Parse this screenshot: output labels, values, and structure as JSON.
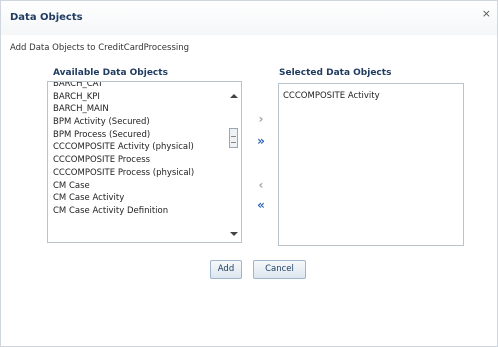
{
  "dialog": {
    "title": "Data Objects",
    "close_glyph": "×",
    "subtitle": "Add Data Objects to CreditCardProcessing"
  },
  "available": {
    "header": "Available Data Objects",
    "items": [
      "BARCH_CAT",
      "BARCH_KPI",
      "BARCH_MAIN",
      "BPM Activity (Secured)",
      "BPM Process (Secured)",
      "CCCOMPOSITE Activity (physical)",
      "CCCOMPOSITE Process",
      "CCCOMPOSITE Process (physical)",
      "CM Case",
      "CM Case Activity",
      "CM Case Activity Definition"
    ]
  },
  "selected": {
    "header": "Selected Data Objects",
    "items": [
      "CCCOMPOSITE Activity"
    ]
  },
  "shuttle": {
    "move_glyph": "›",
    "move_all_glyph": "»",
    "remove_glyph": "‹",
    "remove_all_glyph": "«",
    "enabled_color": "#2d63b8",
    "disabled_color": "#9aa5b0"
  },
  "buttons": {
    "add_label": "Add",
    "cancel_label": "Cancel"
  },
  "icons": {
    "scroll_up": "scroll-up-arrow-icon",
    "scroll_down": "scroll-down-arrow-icon",
    "close": "close-icon",
    "move": "move-right-icon",
    "move_all": "move-all-right-icon",
    "remove": "move-left-icon",
    "remove_all": "move-all-left-icon"
  }
}
